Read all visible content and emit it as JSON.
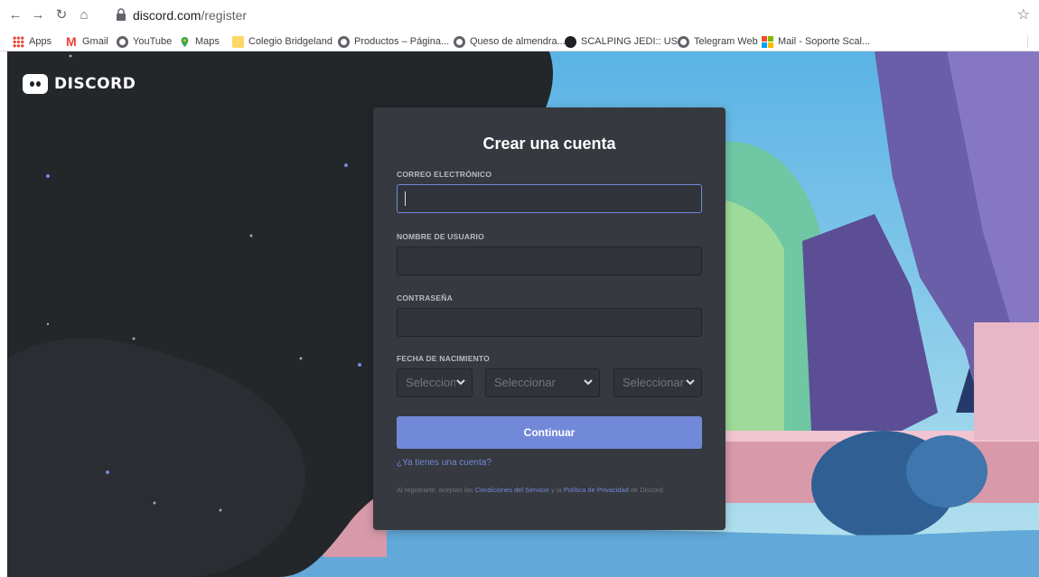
{
  "browser": {
    "url_host": "discord.com",
    "url_path": "/register",
    "bookmarks": [
      {
        "label": "Apps",
        "icon": "apps-grid-icon"
      },
      {
        "label": "Gmail",
        "icon": "gmail-icon"
      },
      {
        "label": "YouTube",
        "icon": "globe-icon"
      },
      {
        "label": "Maps",
        "icon": "maps-pin-icon"
      },
      {
        "label": "Colegio Bridgeland",
        "icon": "folder-icon"
      },
      {
        "label": "Productos – Página...",
        "icon": "globe-icon"
      },
      {
        "label": "Queso de almendra...",
        "icon": "globe-icon"
      },
      {
        "label": "SCALPING JEDI:: US...",
        "icon": "jedi-icon"
      },
      {
        "label": "Telegram Web",
        "icon": "globe-icon"
      },
      {
        "label": "Mail - Soporte Scal...",
        "icon": "microsoft-icon"
      }
    ]
  },
  "brand": {
    "logo_text": "DISCORD",
    "accent_color": "#7289da"
  },
  "form": {
    "title": "Crear una cuenta",
    "email_label": "CORREO ELECTRÓNICO",
    "email_value": "",
    "username_label": "NOMBRE DE USUARIO",
    "username_value": "",
    "password_label": "CONTRASEÑA",
    "password_value": "",
    "birthdate_label": "FECHA DE NACIMIENTO",
    "day_select": "Seleccionar",
    "month_select": "Seleccionar",
    "year_select": "Seleccionar",
    "continue_label": "Continuar",
    "login_link": "¿Ya tienes una cuenta?",
    "terms_prefix": "Al registrarte, aceptas las",
    "terms_link": "Condiciones del Servicio",
    "terms_middle": "y la",
    "privacy_link": "Política de Privacidad",
    "terms_suffix": "de Discord."
  }
}
